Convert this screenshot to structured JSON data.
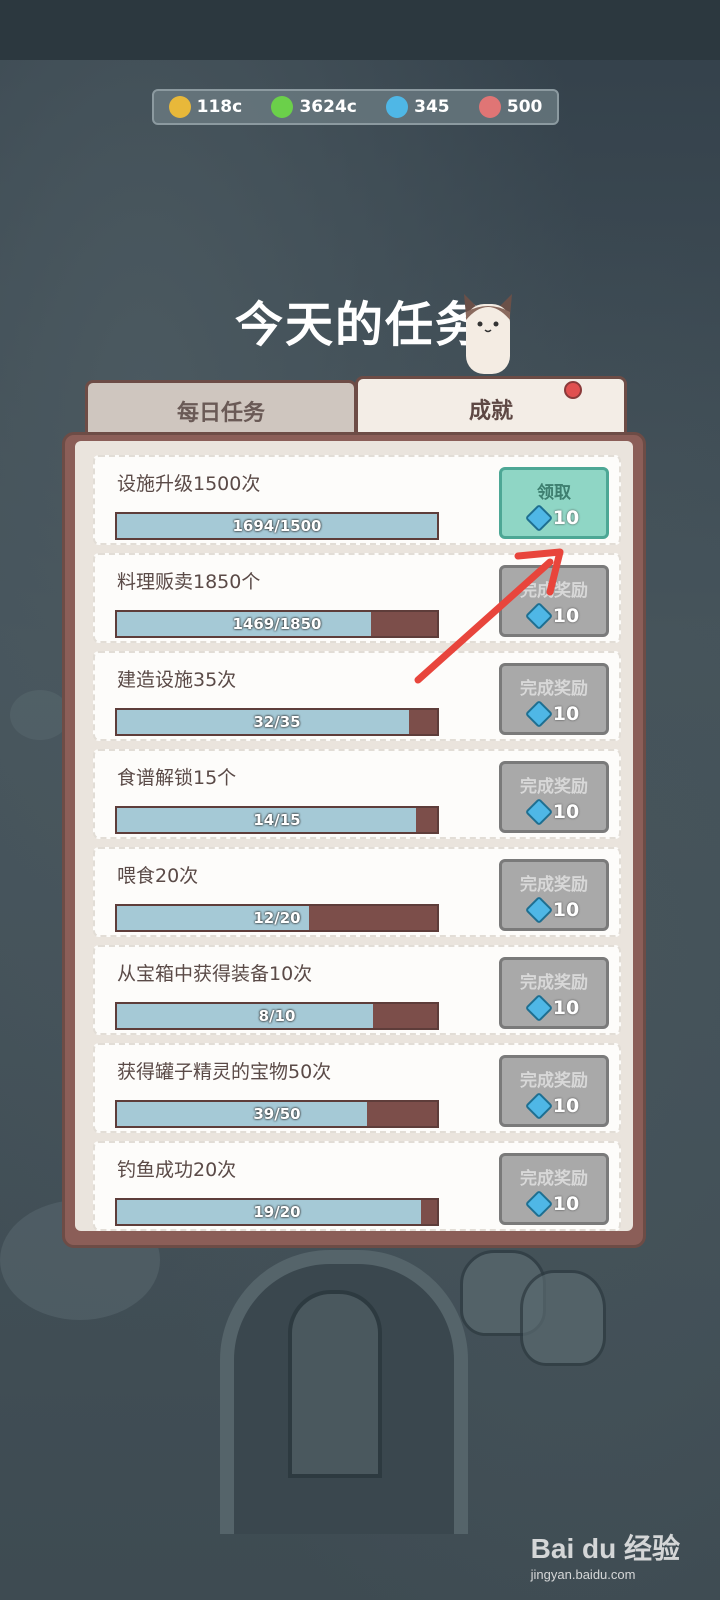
{
  "resources": [
    {
      "icon": "coin-icon",
      "value": "118c",
      "color": "#e8b83a"
    },
    {
      "icon": "lightning-icon",
      "value": "3624c",
      "color": "#6bd04a"
    },
    {
      "icon": "gem-icon",
      "value": "345",
      "color": "#4fb7e6"
    },
    {
      "icon": "meat-icon",
      "value": "500",
      "color": "#e07575"
    }
  ],
  "title": "今天的任务",
  "tabs": {
    "daily": "每日任务",
    "achievements": "成就"
  },
  "tasks": [
    {
      "label": "设施升级1500次",
      "progress": "1694/1500",
      "fraction": 1.0,
      "button": "领取",
      "reward": "10",
      "claimable": true
    },
    {
      "label": "料理贩卖1850个",
      "progress": "1469/1850",
      "fraction": 0.794,
      "button": "完成奖励",
      "reward": "10",
      "claimable": false
    },
    {
      "label": "建造设施35次",
      "progress": "32/35",
      "fraction": 0.914,
      "button": "完成奖励",
      "reward": "10",
      "claimable": false
    },
    {
      "label": "食谱解锁15个",
      "progress": "14/15",
      "fraction": 0.933,
      "button": "完成奖励",
      "reward": "10",
      "claimable": false
    },
    {
      "label": "喂食20次",
      "progress": "12/20",
      "fraction": 0.6,
      "button": "完成奖励",
      "reward": "10",
      "claimable": false
    },
    {
      "label": "从宝箱中获得装备10次",
      "progress": "8/10",
      "fraction": 0.8,
      "button": "完成奖励",
      "reward": "10",
      "claimable": false
    },
    {
      "label": "获得罐子精灵的宝物50次",
      "progress": "39/50",
      "fraction": 0.78,
      "button": "完成奖励",
      "reward": "10",
      "claimable": false
    },
    {
      "label": "钓鱼成功20次",
      "progress": "19/20",
      "fraction": 0.95,
      "button": "完成奖励",
      "reward": "10",
      "claimable": false
    }
  ],
  "watermark": {
    "logo": "Bai du 经验",
    "url": "jingyan.baidu.com"
  }
}
